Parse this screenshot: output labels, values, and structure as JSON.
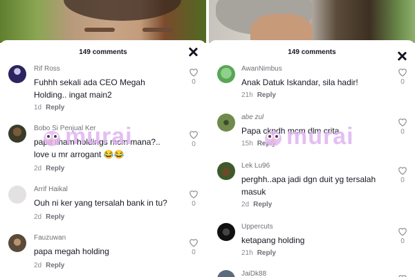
{
  "left": {
    "comment_count": "149 comments",
    "comments": [
      {
        "user": "Rif Ross",
        "text": "Fuhhh sekali ada CEO Megah Holding.. ingat main2",
        "age": "1d",
        "reply": "Reply",
        "likes": "0"
      },
      {
        "user": "Bobo Si Penjual Ker",
        "text": "papa ilham holdings mcm mana?.. love u mr arrogant 😂😂",
        "age": "2d",
        "reply": "Reply",
        "likes": "0"
      },
      {
        "user": "Arrif Haikal",
        "text": "Ouh ni ker yang tersalah bank in tu?",
        "age": "2d",
        "reply": "Reply",
        "likes": "0"
      },
      {
        "user": "Fauzuwan",
        "text": "papa megah holding",
        "age": "2d",
        "reply": "Reply",
        "likes": "0"
      }
    ]
  },
  "right": {
    "comment_count": "149 comments",
    "comments": [
      {
        "user": "AwanNimbus",
        "text": "Anak Datuk Iskandar, sila hadir!",
        "age": "21h",
        "reply": "Reply",
        "likes": "0"
      },
      {
        "user": "abe zul",
        "text": "Papa ckpdh mcm dlm crita",
        "age": "15h",
        "reply": "Reply",
        "likes": "0"
      },
      {
        "user": "Lek Lu96",
        "text": "perghh..apa jadi dgn duit yg tersalah masuk",
        "age": "2d",
        "reply": "Reply",
        "likes": "0"
      },
      {
        "user": "Uppercuts",
        "text": "ketapang holding",
        "age": "21h",
        "reply": "Reply",
        "likes": "0"
      },
      {
        "user": "JaiDk88",
        "text": "",
        "age": "",
        "reply": "",
        "likes": ""
      }
    ]
  },
  "watermark": "murai",
  "colors": {
    "text": "#161823",
    "muted": "#8a8b91",
    "watermark": "#e0b3f3"
  }
}
